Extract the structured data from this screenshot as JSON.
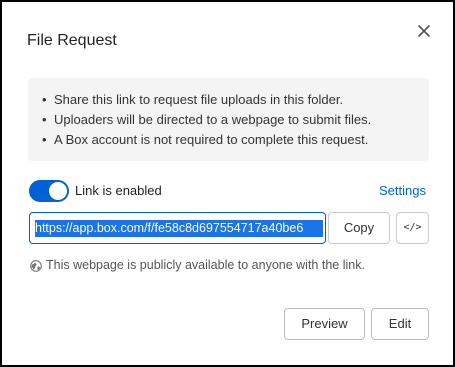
{
  "dialog": {
    "title": "File Request",
    "close_icon": "close-icon"
  },
  "info": {
    "items": [
      "Share this link to request file uploads in this folder.",
      "Uploaders will be directed to a webpage to submit files.",
      "A Box account is not required to complete this request."
    ]
  },
  "link": {
    "toggle_label": "Link is enabled",
    "toggle_on": true,
    "settings_label": "Settings",
    "url": "https://app.box.com/f/fe58c8d697554717a40be6",
    "copy_label": "Copy",
    "embed_label": "</>",
    "public_note": "This webpage is publicly available to anyone with the link.",
    "globe_icon": "globe-icon"
  },
  "footer": {
    "preview_label": "Preview",
    "edit_label": "Edit"
  },
  "colors": {
    "accent": "#0061d5",
    "selection": "#1a73e8",
    "info_bg": "#f4f4f4"
  }
}
